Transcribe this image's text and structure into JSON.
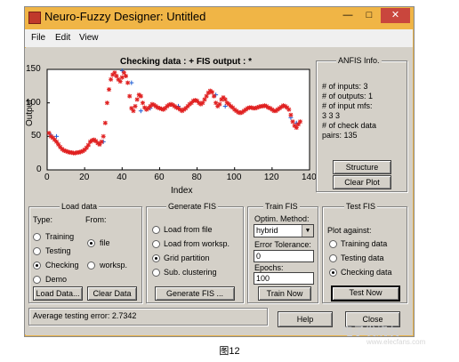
{
  "window": {
    "title": "Neuro-Fuzzy Designer: Untitled",
    "minimize_label": "—",
    "maximize_label": "□",
    "close_label": "✕",
    "close_color": "#c9463d",
    "title_color": "#f0b546"
  },
  "menu": {
    "items": [
      "File",
      "Edit",
      "View"
    ]
  },
  "chart": {
    "title": "Checking data : +    FIS output : *",
    "xlabel": "Index",
    "ylabel": "Output",
    "xticks": [
      "0",
      "20",
      "40",
      "60",
      "80",
      "100",
      "120",
      "140"
    ],
    "yticks": [
      "0",
      "50",
      "100",
      "150"
    ]
  },
  "chart_data": {
    "type": "scatter",
    "title": "Checking data : +    FIS output : *",
    "xlabel": "Index",
    "ylabel": "Output",
    "xlim": [
      0,
      140
    ],
    "ylim": [
      0,
      150
    ],
    "grid": false,
    "series": [
      {
        "name": "Checking data",
        "marker": "+",
        "color": "#1f5fd6",
        "x": [
          2,
          5,
          30,
          40,
          42,
          45,
          50,
          55,
          70,
          90,
          95,
          130,
          133
        ],
        "y": [
          52,
          50,
          42,
          148,
          140,
          130,
          88,
          92,
          95,
          112,
          95,
          78,
          70
        ]
      },
      {
        "name": "FIS output",
        "marker": "*",
        "color": "#e02020",
        "x": [
          1,
          2,
          3,
          4,
          5,
          6,
          7,
          8,
          9,
          10,
          11,
          12,
          13,
          14,
          15,
          16,
          17,
          18,
          19,
          20,
          21,
          22,
          23,
          24,
          25,
          26,
          27,
          28,
          29,
          30,
          31,
          32,
          33,
          34,
          35,
          36,
          37,
          38,
          39,
          40,
          41,
          42,
          43,
          44,
          45,
          46,
          47,
          48,
          49,
          50,
          51,
          52,
          53,
          54,
          55,
          56,
          57,
          58,
          59,
          60,
          61,
          62,
          63,
          64,
          65,
          66,
          67,
          68,
          69,
          70,
          71,
          72,
          73,
          74,
          75,
          76,
          77,
          78,
          79,
          80,
          81,
          82,
          83,
          84,
          85,
          86,
          87,
          88,
          89,
          90,
          91,
          92,
          93,
          94,
          95,
          96,
          97,
          98,
          99,
          100,
          101,
          102,
          103,
          104,
          105,
          106,
          107,
          108,
          109,
          110,
          111,
          112,
          113,
          114,
          115,
          116,
          117,
          118,
          119,
          120,
          121,
          122,
          123,
          124,
          125,
          126,
          127,
          128,
          129,
          130,
          131,
          132,
          133,
          134,
          135
        ],
        "y": [
          55,
          50,
          48,
          45,
          42,
          38,
          34,
          31,
          29,
          28,
          27,
          26,
          26,
          25,
          25,
          26,
          26,
          27,
          28,
          30,
          33,
          37,
          42,
          44,
          45,
          43,
          40,
          38,
          42,
          50,
          70,
          100,
          120,
          135,
          142,
          145,
          140,
          135,
          132,
          138,
          145,
          140,
          130,
          110,
          92,
          88,
          95,
          105,
          112,
          110,
          100,
          93,
          90,
          92,
          95,
          98,
          97,
          95,
          93,
          92,
          91,
          90,
          92,
          95,
          97,
          98,
          97,
          95,
          93,
          92,
          90,
          88,
          90,
          92,
          95,
          98,
          100,
          103,
          104,
          103,
          100,
          98,
          100,
          105,
          110,
          115,
          118,
          116,
          110,
          100,
          95,
          98,
          105,
          108,
          105,
          100,
          98,
          95,
          93,
          90,
          88,
          86,
          85,
          86,
          88,
          90,
          92,
          93,
          93,
          92,
          92,
          93,
          94,
          95,
          95,
          96,
          95,
          93,
          92,
          90,
          88,
          88,
          90,
          92,
          94,
          96,
          95,
          93,
          90,
          82,
          72,
          66,
          63,
          68,
          72
        ]
      }
    ]
  },
  "anfis_info": {
    "title": "ANFIS Info.",
    "lines": [
      "# of inputs: 3",
      "# of outputs: 1",
      "# of input mfs:",
      "3  3  3",
      "# of check data",
      "pairs: 135"
    ],
    "structure_button": "Structure",
    "clear_plot_button": "Clear Plot"
  },
  "load_data": {
    "title": "Load data",
    "type_label": "Type:",
    "from_label": "From:",
    "types": [
      {
        "label": "Training",
        "selected": false
      },
      {
        "label": "Testing",
        "selected": false
      },
      {
        "label": "Checking",
        "selected": true
      },
      {
        "label": "Demo",
        "selected": false
      }
    ],
    "sources": [
      {
        "label": "file",
        "selected": true
      },
      {
        "label": "worksp.",
        "selected": false
      }
    ],
    "load_button": "Load Data...",
    "clear_button": "Clear Data"
  },
  "generate_fis": {
    "title": "Generate FIS",
    "options": [
      {
        "label": "Load from file",
        "selected": false
      },
      {
        "label": "Load from worksp.",
        "selected": false
      },
      {
        "label": "Grid partition",
        "selected": true
      },
      {
        "label": "Sub. clustering",
        "selected": false
      }
    ],
    "button": "Generate FIS ..."
  },
  "train_fis": {
    "title": "Train FIS",
    "method_label": "Optim. Method:",
    "method_value": "hybrid",
    "tolerance_label": "Error Tolerance:",
    "tolerance_value": "0",
    "epochs_label": "Epochs:",
    "epochs_value": "100",
    "button": "Train Now"
  },
  "test_fis": {
    "title": "Test FIS",
    "plot_against_label": "Plot against:",
    "options": [
      {
        "label": "Training data",
        "selected": false
      },
      {
        "label": "Testing data",
        "selected": false
      },
      {
        "label": "Checking data",
        "selected": true
      }
    ],
    "button": "Test Now"
  },
  "status": {
    "text": "Average testing error: 2.7342",
    "help_button": "Help",
    "close_button": "Close"
  },
  "caption": "图12",
  "watermark": {
    "main": "电子发烧友",
    "sub": "www.elecfans.com"
  }
}
